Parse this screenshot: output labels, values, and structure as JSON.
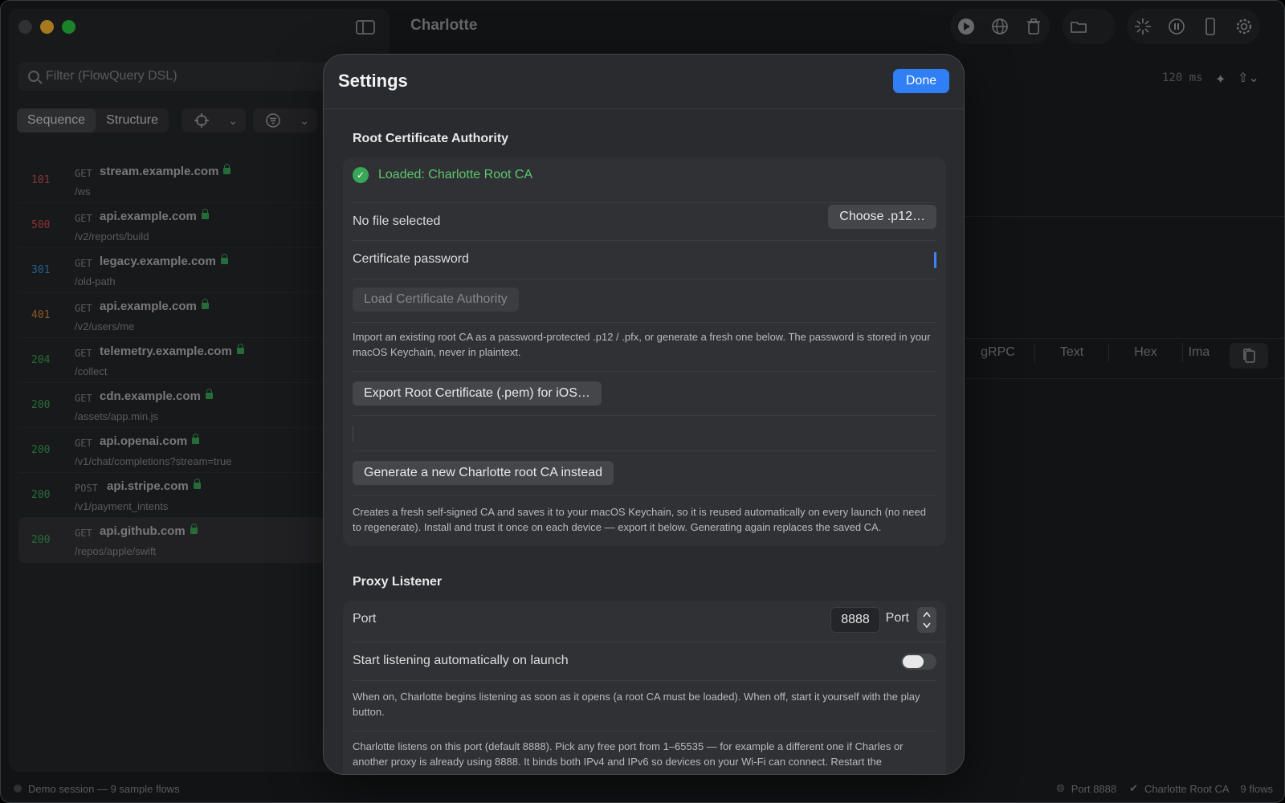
{
  "window": {
    "title": "Charlotte"
  },
  "sidebar": {
    "filter_placeholder": "Filter (FlowQuery DSL)",
    "view_modes": [
      "Sequence",
      "Structure"
    ],
    "flows": [
      {
        "status": "101",
        "method": "GET",
        "host": "stream.example.com",
        "path": "/ws"
      },
      {
        "status": "500",
        "method": "GET",
        "host": "api.example.com",
        "path": "/v2/reports/build"
      },
      {
        "status": "301",
        "method": "GET",
        "host": "legacy.example.com",
        "path": "/old-path"
      },
      {
        "status": "401",
        "method": "GET",
        "host": "api.example.com",
        "path": "/v2/users/me"
      },
      {
        "status": "204",
        "method": "GET",
        "host": "telemetry.example.com",
        "path": "/collect"
      },
      {
        "status": "200",
        "method": "GET",
        "host": "cdn.example.com",
        "path": "/assets/app.min.js"
      },
      {
        "status": "200",
        "method": "GET",
        "host": "api.openai.com",
        "path": "/v1/chat/completions?stream=true"
      },
      {
        "status": "200",
        "method": "POST",
        "host": "api.stripe.com",
        "path": "/v1/payment_intents"
      },
      {
        "status": "200",
        "method": "GET",
        "host": "api.github.com",
        "path": "/repos/apple/swift"
      }
    ]
  },
  "detail": {
    "timing": "120 ms",
    "view_tabs": [
      "gRPC",
      "Text",
      "Hex",
      "Ima"
    ]
  },
  "statusbar": {
    "session": "Demo session — 9 sample flows",
    "port": "Port 8888",
    "ca": "Charlotte Root CA",
    "flows": "9 flows"
  },
  "settings": {
    "title": "Settings",
    "done_label": "Done",
    "root_ca": {
      "section_title": "Root Certificate Authority",
      "loaded_status": "Loaded: Charlotte Root CA",
      "file_label": "No file selected",
      "choose_label": "Choose .p12…",
      "password_label": "Certificate password",
      "load_label": "Load Certificate Authority",
      "import_help": "Import an existing root CA as a password-protected .p12 / .pfx, or generate a fresh one below. The password is stored in your macOS Keychain, never in plaintext.",
      "export_label": "Export Root Certificate (.pem) for iOS…",
      "generate_label": "Generate a new Charlotte root CA instead",
      "generate_help": "Creates a fresh self-signed CA and saves it to your macOS Keychain, so it is reused automatically on every launch (no need to regenerate). Install and trust it once on each device — export it below. Generating again replaces the saved CA."
    },
    "proxy": {
      "section_title": "Proxy Listener",
      "port_label": "Port",
      "port_value": "8888",
      "port_unit": "Port",
      "autostart_label": "Start listening automatically on launch",
      "autostart_help": "When on, Charlotte begins listening as soon as it opens (a root CA must be loaded). When off, start it yourself with the play button.",
      "port_help": "Charlotte listens on this port (default 8888). Pick any free port from 1–65535 — for example a different one if Charles or another proxy is already using 8888. It binds both IPv4 and IPv6 so devices on your Wi-Fi can connect. Restart the"
    }
  },
  "colors": {
    "accent": "#2f7ff6",
    "success": "#3aa657",
    "error": "#d34b4b",
    "redirect": "#3a94d8",
    "client_error": "#d8873a"
  }
}
